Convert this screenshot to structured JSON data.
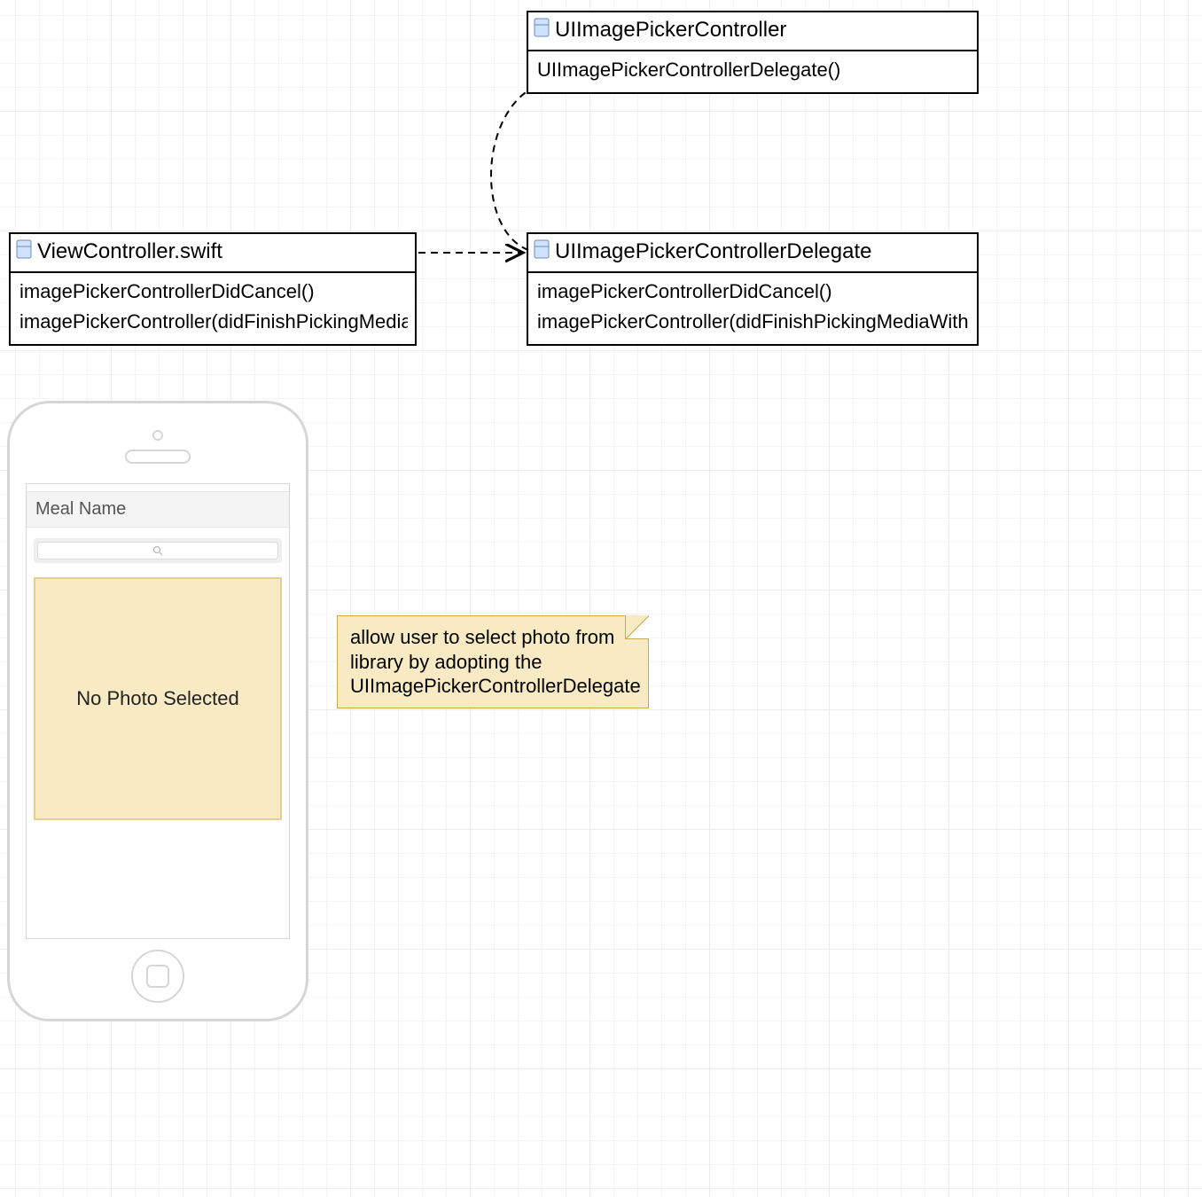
{
  "boxes": {
    "viewController": {
      "title": "ViewController.swift",
      "members": [
        "imagePickerControllerDidCancel()",
        "imagePickerController(didFinishPickingMediaWithInfo)"
      ]
    },
    "pickerDelegate": {
      "title": "UIImagePickerControllerDelegate",
      "members": [
        "imagePickerControllerDidCancel()",
        "imagePickerController(didFinishPickingMediaWithInfo)"
      ]
    },
    "pickerController": {
      "title": "UIImagePickerController",
      "members": [
        "UIImagePickerControllerDelegate()"
      ]
    }
  },
  "note": {
    "text": "allow user to select photo from library by adopting the UIImagePickerControllerDelegate"
  },
  "phone": {
    "fieldLabel": "Meal Name",
    "photoPlaceholder": "No Photo Selected"
  }
}
